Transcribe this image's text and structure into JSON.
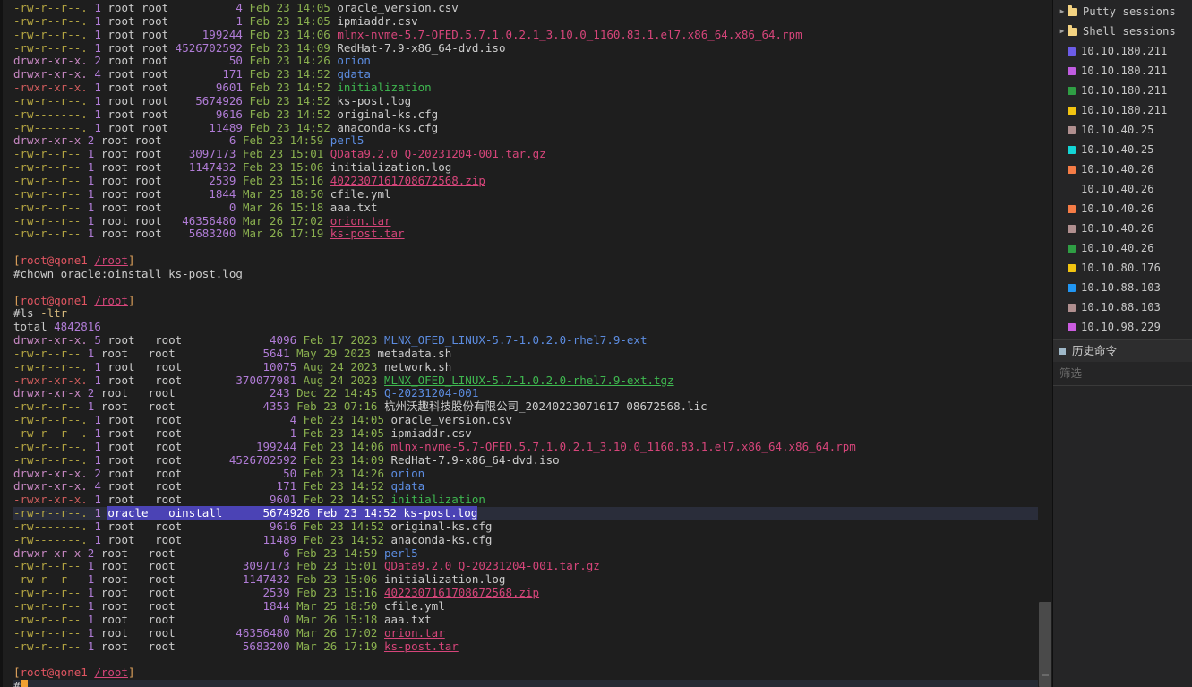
{
  "terminal": {
    "prompt_user": "root",
    "prompt_host": "qone1",
    "prompt_path": "/root",
    "commands": {
      "chown": "#chown oracle:oinstall ks-post.log",
      "ls": "#ls",
      "ls_flag": "-ltr",
      "total_label": "total",
      "total_value": "4842816",
      "final_prompt_char": "#"
    },
    "listing_top": [
      {
        "perm": "-rw-r--r--.",
        "links": "1",
        "owner": "root",
        "group": "root",
        "size": "4",
        "month": "Feb",
        "day": "23",
        "time": "14:05",
        "name": "oracle_version.csv",
        "kind": "file"
      },
      {
        "perm": "-rw-r--r--.",
        "links": "1",
        "owner": "root",
        "group": "root",
        "size": "1",
        "month": "Feb",
        "day": "23",
        "time": "14:05",
        "name": "ipmiaddr.csv",
        "kind": "file"
      },
      {
        "perm": "-rw-r--r--.",
        "links": "1",
        "owner": "root",
        "group": "root",
        "size": "199244",
        "month": "Feb",
        "day": "23",
        "time": "14:06",
        "name": "mlnx-nvme-5.7-OFED.5.7.1.0.2.1_3.10.0_1160.83.1.el7.x86_64.x86_64.rpm",
        "kind": "rpm"
      },
      {
        "perm": "-rw-r--r--.",
        "links": "1",
        "owner": "root",
        "group": "root",
        "size": "4526702592",
        "month": "Feb",
        "day": "23",
        "time": "14:09",
        "name": "RedHat-7.9-x86_64-dvd.iso",
        "kind": "file"
      },
      {
        "perm": "drwxr-xr-x.",
        "links": "2",
        "owner": "root",
        "group": "root",
        "size": "50",
        "month": "Feb",
        "day": "23",
        "time": "14:26",
        "name": "orion",
        "kind": "dir"
      },
      {
        "perm": "drwxr-xr-x.",
        "links": "4",
        "owner": "root",
        "group": "root",
        "size": "171",
        "month": "Feb",
        "day": "23",
        "time": "14:52",
        "name": "qdata",
        "kind": "dir"
      },
      {
        "perm": "-rwxr-xr-x.",
        "links": "1",
        "owner": "root",
        "group": "root",
        "size": "9601",
        "month": "Feb",
        "day": "23",
        "time": "14:52",
        "name": "initialization",
        "kind": "exec"
      },
      {
        "perm": "-rw-r--r--.",
        "links": "1",
        "owner": "root",
        "group": "root",
        "size": "5674926",
        "month": "Feb",
        "day": "23",
        "time": "14:52",
        "name": "ks-post.log",
        "kind": "file"
      },
      {
        "perm": "-rw-------.",
        "links": "1",
        "owner": "root",
        "group": "root",
        "size": "9616",
        "month": "Feb",
        "day": "23",
        "time": "14:52",
        "name": "original-ks.cfg",
        "kind": "file"
      },
      {
        "perm": "-rw-------.",
        "links": "1",
        "owner": "root",
        "group": "root",
        "size": "11489",
        "month": "Feb",
        "day": "23",
        "time": "14:52",
        "name": "anaconda-ks.cfg",
        "kind": "file"
      },
      {
        "perm": "drwxr-xr-x",
        "links": "2",
        "owner": "root",
        "group": "root",
        "size": "6",
        "month": "Feb",
        "day": "23",
        "time": "14:59",
        "name": "perl5",
        "kind": "dir"
      },
      {
        "perm": "-rw-r--r--",
        "links": "1",
        "owner": "root",
        "group": "root",
        "size": "3097173",
        "month": "Feb",
        "day": "23",
        "time": "15:01",
        "name": "QData9.2.0_Q-20231204-001.tar.gz",
        "kind": "targz"
      },
      {
        "perm": "-rw-r--r--",
        "links": "1",
        "owner": "root",
        "group": "root",
        "size": "1147432",
        "month": "Feb",
        "day": "23",
        "time": "15:06",
        "name": "initialization.log",
        "kind": "file"
      },
      {
        "perm": "-rw-r--r--",
        "links": "1",
        "owner": "root",
        "group": "root",
        "size": "2539",
        "month": "Feb",
        "day": "23",
        "time": "15:16",
        "name": "4022307161708672568.zip",
        "kind": "arch"
      },
      {
        "perm": "-rw-r--r--",
        "links": "1",
        "owner": "root",
        "group": "root",
        "size": "1844",
        "month": "Mar",
        "day": "25",
        "time": "18:50",
        "name": "cfile.yml",
        "kind": "file"
      },
      {
        "perm": "-rw-r--r--",
        "links": "1",
        "owner": "root",
        "group": "root",
        "size": "0",
        "month": "Mar",
        "day": "26",
        "time": "15:18",
        "name": "aaa.txt",
        "kind": "file"
      },
      {
        "perm": "-rw-r--r--",
        "links": "1",
        "owner": "root",
        "group": "root",
        "size": "46356480",
        "month": "Mar",
        "day": "26",
        "time": "17:02",
        "name": "orion.tar",
        "kind": "arch"
      },
      {
        "perm": "-rw-r--r--",
        "links": "1",
        "owner": "root",
        "group": "root",
        "size": "5683200",
        "month": "Mar",
        "day": "26",
        "time": "17:19",
        "name": "ks-post.tar",
        "kind": "arch"
      }
    ],
    "listing_bottom": [
      {
        "perm": "drwxr-xr-x.",
        "links": "5",
        "owner": "root",
        "group": "root",
        "size": "4096",
        "month": "Feb",
        "day": "17",
        "time": "2023",
        "name": "MLNX_OFED_LINUX-5.7-1.0.2.0-rhel7.9-ext",
        "kind": "dir"
      },
      {
        "perm": "-rw-r--r--",
        "links": "1",
        "owner": "root",
        "group": "root",
        "size": "5641",
        "month": "May",
        "day": "29",
        "time": "2023",
        "name": "metadata.sh",
        "kind": "file"
      },
      {
        "perm": "-rw-r--r--.",
        "links": "1",
        "owner": "root",
        "group": "root",
        "size": "10075",
        "month": "Aug",
        "day": "24",
        "time": "2023",
        "name": "network.sh",
        "kind": "file"
      },
      {
        "perm": "-rwxr-xr-x.",
        "links": "1",
        "owner": "root",
        "group": "root",
        "size": "370077981",
        "month": "Aug",
        "day": "24",
        "time": "2023",
        "name": "MLNX_OFED_LINUX-5.7-1.0.2.0-rhel7.9-ext.tgz",
        "kind": "exec-arch"
      },
      {
        "perm": "drwxr-xr-x",
        "links": "2",
        "owner": "root",
        "group": "root",
        "size": "243",
        "month": "Dec",
        "day": "22",
        "time": "14:45",
        "name": "Q-20231204-001",
        "kind": "dir"
      },
      {
        "perm": "-rw-r--r--",
        "links": "1",
        "owner": "root",
        "group": "root",
        "size": "4353",
        "month": "Feb",
        "day": "23",
        "time": "07:16",
        "name": "杭州沃趣科技股份有限公司_20240223071617 08672568.lic",
        "kind": "file"
      },
      {
        "perm": "-rw-r--r--.",
        "links": "1",
        "owner": "root",
        "group": "root",
        "size": "4",
        "month": "Feb",
        "day": "23",
        "time": "14:05",
        "name": "oracle_version.csv",
        "kind": "file"
      },
      {
        "perm": "-rw-r--r--.",
        "links": "1",
        "owner": "root",
        "group": "root",
        "size": "1",
        "month": "Feb",
        "day": "23",
        "time": "14:05",
        "name": "ipmiaddr.csv",
        "kind": "file"
      },
      {
        "perm": "-rw-r--r--.",
        "links": "1",
        "owner": "root",
        "group": "root",
        "size": "199244",
        "month": "Feb",
        "day": "23",
        "time": "14:06",
        "name": "mlnx-nvme-5.7-OFED.5.7.1.0.2.1_3.10.0_1160.83.1.el7.x86_64.x86_64.rpm",
        "kind": "rpm"
      },
      {
        "perm": "-rw-r--r--.",
        "links": "1",
        "owner": "root",
        "group": "root",
        "size": "4526702592",
        "month": "Feb",
        "day": "23",
        "time": "14:09",
        "name": "RedHat-7.9-x86_64-dvd.iso",
        "kind": "file"
      },
      {
        "perm": "drwxr-xr-x.",
        "links": "2",
        "owner": "root",
        "group": "root",
        "size": "50",
        "month": "Feb",
        "day": "23",
        "time": "14:26",
        "name": "orion",
        "kind": "dir"
      },
      {
        "perm": "drwxr-xr-x.",
        "links": "4",
        "owner": "root",
        "group": "root",
        "size": "171",
        "month": "Feb",
        "day": "23",
        "time": "14:52",
        "name": "qdata",
        "kind": "dir"
      },
      {
        "perm": "-rwxr-xr-x.",
        "links": "1",
        "owner": "root",
        "group": "root",
        "size": "9601",
        "month": "Feb",
        "day": "23",
        "time": "14:52",
        "name": "initialization",
        "kind": "exec"
      },
      {
        "perm": "-rw-r--r--.",
        "links": "1",
        "owner": "oracle",
        "group": "oinstall",
        "size": "5674926",
        "month": "Feb",
        "day": "23",
        "time": "14:52",
        "name": "ks-post.log",
        "kind": "file",
        "selected": true
      },
      {
        "perm": "-rw-------.",
        "links": "1",
        "owner": "root",
        "group": "root",
        "size": "9616",
        "month": "Feb",
        "day": "23",
        "time": "14:52",
        "name": "original-ks.cfg",
        "kind": "file"
      },
      {
        "perm": "-rw-------.",
        "links": "1",
        "owner": "root",
        "group": "root",
        "size": "11489",
        "month": "Feb",
        "day": "23",
        "time": "14:52",
        "name": "anaconda-ks.cfg",
        "kind": "file"
      },
      {
        "perm": "drwxr-xr-x",
        "links": "2",
        "owner": "root",
        "group": "root",
        "size": "6",
        "month": "Feb",
        "day": "23",
        "time": "14:59",
        "name": "perl5",
        "kind": "dir"
      },
      {
        "perm": "-rw-r--r--",
        "links": "1",
        "owner": "root",
        "group": "root",
        "size": "3097173",
        "month": "Feb",
        "day": "23",
        "time": "15:01",
        "name": "QData9.2.0_Q-20231204-001.tar.gz",
        "kind": "targz"
      },
      {
        "perm": "-rw-r--r--",
        "links": "1",
        "owner": "root",
        "group": "root",
        "size": "1147432",
        "month": "Feb",
        "day": "23",
        "time": "15:06",
        "name": "initialization.log",
        "kind": "file"
      },
      {
        "perm": "-rw-r--r--",
        "links": "1",
        "owner": "root",
        "group": "root",
        "size": "2539",
        "month": "Feb",
        "day": "23",
        "time": "15:16",
        "name": "4022307161708672568.zip",
        "kind": "arch"
      },
      {
        "perm": "-rw-r--r--",
        "links": "1",
        "owner": "root",
        "group": "root",
        "size": "1844",
        "month": "Mar",
        "day": "25",
        "time": "18:50",
        "name": "cfile.yml",
        "kind": "file"
      },
      {
        "perm": "-rw-r--r--",
        "links": "1",
        "owner": "root",
        "group": "root",
        "size": "0",
        "month": "Mar",
        "day": "26",
        "time": "15:18",
        "name": "aaa.txt",
        "kind": "file"
      },
      {
        "perm": "-rw-r--r--",
        "links": "1",
        "owner": "root",
        "group": "root",
        "size": "46356480",
        "month": "Mar",
        "day": "26",
        "time": "17:02",
        "name": "orion.tar",
        "kind": "arch"
      },
      {
        "perm": "-rw-r--r--",
        "links": "1",
        "owner": "root",
        "group": "root",
        "size": "5683200",
        "month": "Mar",
        "day": "26",
        "time": "17:19",
        "name": "ks-post.tar",
        "kind": "arch"
      }
    ]
  },
  "sidebar": {
    "folders": [
      {
        "label": "Putty sessions",
        "icon": "folder-icon",
        "arrow": "chevron-right-icon"
      },
      {
        "label": "Shell sessions",
        "icon": "folder-icon",
        "arrow": "chevron-right-icon"
      }
    ],
    "sessions": [
      {
        "label": "10.10.180.211",
        "color": "#6c5ce7"
      },
      {
        "label": "10.10.180.211",
        "color": "#c05ce0"
      },
      {
        "label": "10.10.180.211",
        "color": "#2f9e44"
      },
      {
        "label": "10.10.180.211",
        "color": "#f2c411"
      },
      {
        "label": "10.10.40.25",
        "color": "#b08f8f"
      },
      {
        "label": "10.10.40.25",
        "color": "#14d5d5"
      },
      {
        "label": "10.10.40.26",
        "color": "#f57c46"
      },
      {
        "label": "10.10.40.26",
        "color": ""
      },
      {
        "label": "10.10.40.26",
        "color": "#f57c46"
      },
      {
        "label": "10.10.40.26",
        "color": "#b08f8f"
      },
      {
        "label": "10.10.40.26",
        "color": "#2f9e44"
      },
      {
        "label": "10.10.80.176",
        "color": "#f2c411"
      },
      {
        "label": "10.10.88.103",
        "color": "#2196f3"
      },
      {
        "label": "10.10.88.103",
        "color": "#b08f8f"
      },
      {
        "label": "10.10.98.229",
        "color": "#cc5ce0"
      }
    ],
    "history": {
      "label": "历史命令",
      "icon": "square-icon"
    },
    "filter": {
      "placeholder": "筛选",
      "value": ""
    }
  },
  "colors": {
    "terminal_bg": "#1e1e1e",
    "sidebar_bg": "#252526",
    "selection": "#4b43b5",
    "cursor": "#f0a030"
  }
}
